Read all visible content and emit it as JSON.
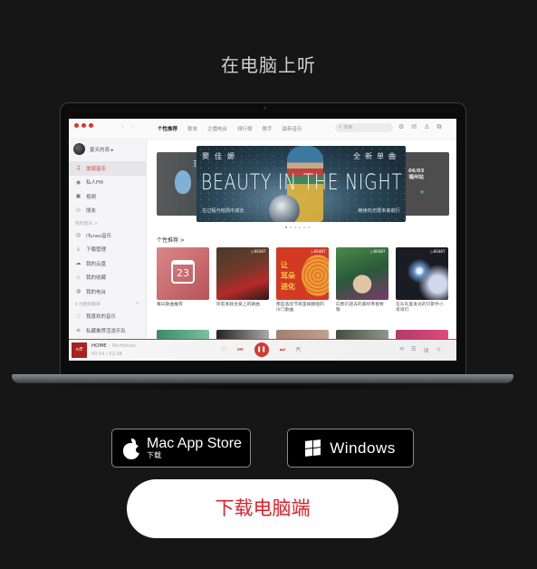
{
  "page": {
    "title": "在电脑上听",
    "download_button": "下载电脑端",
    "mac_store": {
      "title": "Mac App Store",
      "subtitle": "下载"
    },
    "windows": {
      "title": "Windows"
    }
  },
  "app": {
    "nav_tabs": [
      "个性推荐",
      "歌单",
      "主播电台",
      "排行榜",
      "歌手",
      "最新音乐"
    ],
    "active_tab": "个性推荐",
    "search_placeholder": "搜索",
    "top_icons": [
      "settings-icon",
      "mail-icon",
      "skin-icon",
      "mini-mode-icon"
    ],
    "user": {
      "name": "夏天的浪 ▸"
    },
    "sidebar": {
      "items": [
        {
          "label": "发现音乐",
          "icon": "♫",
          "active": true
        },
        {
          "label": "私人FM",
          "icon": "◉"
        },
        {
          "label": "视频",
          "icon": "▣"
        },
        {
          "label": "朋友",
          "icon": "⚇"
        }
      ],
      "my_music_header": "我的音乐 >",
      "my_music": [
        {
          "label": "iTunes音乐",
          "icon": "◎"
        },
        {
          "label": "下载管理",
          "icon": "⤓"
        },
        {
          "label": "我的云盘",
          "icon": "☁"
        },
        {
          "label": "我的收藏",
          "icon": "☆"
        },
        {
          "label": "我的电台",
          "icon": "◍"
        }
      ],
      "created_header": "▾ 创建的歌单",
      "created_add": "+",
      "created": [
        {
          "label": "我喜欢的音乐",
          "icon": "♡"
        },
        {
          "label": "私藏推荐活泼乐队",
          "icon": "≡"
        }
      ]
    },
    "banner": {
      "artist": "窦佳嫄",
      "tag": "全新单曲",
      "headline": "BEAUTY IN THE NIGHT",
      "sub_left": "在过程与结局中成长",
      "sub_right": "继续向无限未来前行",
      "side_left_char": "玥",
      "side_right_date": "06/03",
      "side_right_place": "福州站",
      "pages": 6,
      "current_page": 1
    },
    "section_title": "个性推荐 >",
    "cards": [
      {
        "label": "每日歌曲推荐",
        "calendar_day": "23",
        "playcount": ""
      },
      {
        "label": "听前奏就会爱上的歌曲",
        "playcount": "▷66487"
      },
      {
        "label": "那些逃亮节目里被翻唱的冷门歌曲",
        "playcount": "▷66487",
        "cover_text": "让\n耳朵\n进化"
      },
      {
        "label": "向我们逝去的美好青春致敬",
        "playcount": "▷66487"
      },
      {
        "label": "在乐队里发光的贝斯手小哥哥们",
        "playcount": "▷66487"
      }
    ],
    "player": {
      "song": "HOME",
      "artist": "– Nichkhun",
      "elapsed": "00:54",
      "duration": "02:28",
      "progress": 0.36,
      "thumb_text": "n/E",
      "controls": [
        "like-icon",
        "prev-icon",
        "pause-icon",
        "next-icon",
        "share-icon"
      ],
      "right_controls": [
        "loop-icon",
        "playlist-icon",
        "lyrics-icon",
        "volume-icon"
      ]
    }
  }
}
